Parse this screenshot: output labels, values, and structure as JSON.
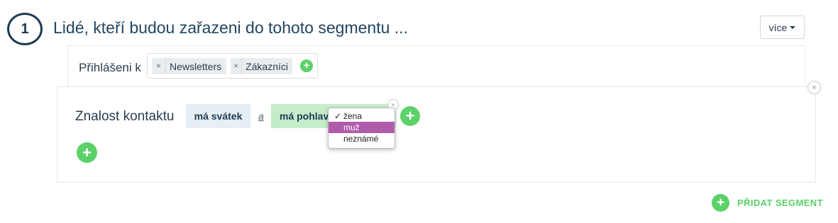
{
  "header": {
    "step_number": "1",
    "title": "Lidé, kteří budou zařazeni do tohoto segmentu ...",
    "more_label": "více"
  },
  "subscribed": {
    "label": "Přihlášeni k",
    "tags": [
      {
        "label": "Newsletters"
      },
      {
        "label": "Zákazníci"
      }
    ],
    "remove_symbol": "×",
    "add_symbol": "+"
  },
  "condition": {
    "label": "Znalost kontaktu",
    "chips": [
      {
        "label": "má svátek"
      },
      {
        "label": "má pohlaví"
      }
    ],
    "connector": "a",
    "remove_symbol": "×",
    "add_symbol": "+"
  },
  "gender_dropdown": {
    "options": [
      {
        "label": "žena",
        "checked": true
      },
      {
        "label": "muž",
        "highlighted": true
      },
      {
        "label": "neznámé"
      }
    ],
    "check_symbol": "✓"
  },
  "footer": {
    "add_segment_label": "PŘIDAT SEGMENT",
    "add_symbol": "+"
  },
  "colors": {
    "accent_green": "#5cd169",
    "dropdown_highlight": "#b05cab",
    "chip_blue": "#e6eff5",
    "chip_green": "#c5ecc9",
    "title_color": "#234560"
  }
}
